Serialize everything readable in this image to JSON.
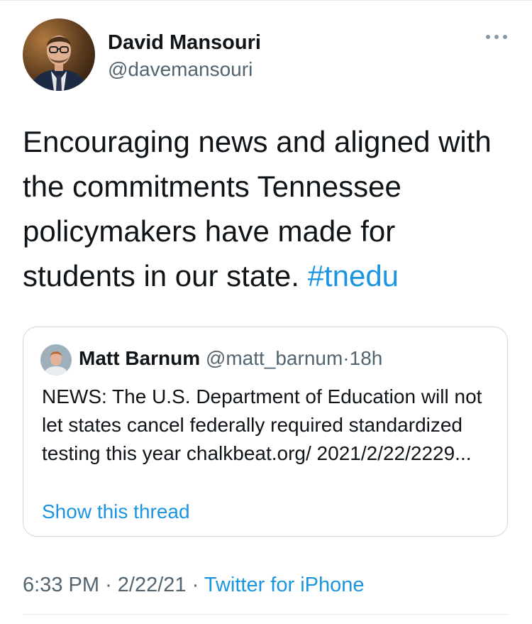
{
  "tweet": {
    "author_name": "David Mansouri",
    "author_handle": "@davemansouri",
    "text_main": "Encouraging news and aligned with the commitments Tennessee policymakers have made for students in our state. ",
    "hashtag": "#tnedu",
    "more_icon": "more-horizontal-icon",
    "avatar_icon": "avatar-photo"
  },
  "quoted_tweet": {
    "author_name": "Matt Barnum",
    "author_handle": "@matt_barnum",
    "separator": "·",
    "time": "18h",
    "text": "NEWS: The U.S. Department of Education will not let states cancel federally required standardized testing this year chalkbeat.org/ 2021/2/22/2229...",
    "show_thread": "Show this thread"
  },
  "meta": {
    "time": "6:33 PM",
    "separator": "·",
    "date": "2/22/21",
    "source": "Twitter for iPhone"
  },
  "colors": {
    "link": "#1b95e0",
    "secondary_text": "#536471",
    "border": "#cfd9de"
  }
}
